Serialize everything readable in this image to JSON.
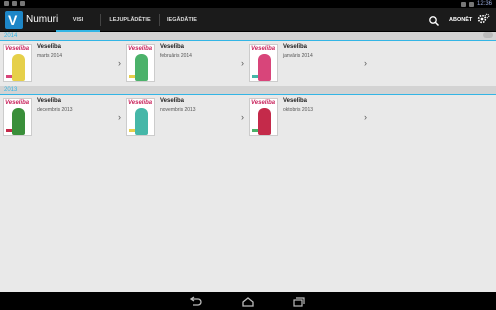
{
  "status_bar": {
    "time": "12:36"
  },
  "action_bar": {
    "title": "Numuri",
    "tabs": [
      {
        "label": "VISI",
        "active": true
      },
      {
        "label": "LEJUPLĀDĒTIE",
        "active": false
      },
      {
        "label": "IEGĀDĀTIE",
        "active": false
      }
    ],
    "subscribe_label": "ABONĒT",
    "icons": [
      "app-logo-icon",
      "search-icon",
      "gear-icon"
    ]
  },
  "sections": [
    {
      "year": "2014",
      "issues": [
        {
          "title": "Veselība",
          "date": "marts 2014"
        },
        {
          "title": "Veselība",
          "date": "februāris 2014"
        },
        {
          "title": "Veselība",
          "date": "janvāris 2014"
        }
      ]
    },
    {
      "year": "2013",
      "issues": [
        {
          "title": "Veselība",
          "date": "decembris 2013"
        },
        {
          "title": "Veselība",
          "date": "novembris 2013"
        },
        {
          "title": "Veselība",
          "date": "oktobris 2013"
        }
      ]
    }
  ],
  "covers": {
    "masthead": "Veselība",
    "colors": [
      "#e6d04a",
      "#4bb26a",
      "#d8457a",
      "#3a8f3a",
      "#45b7a8",
      "#c42a4a"
    ]
  },
  "nav_bar": {
    "icons": [
      "back-icon",
      "home-icon",
      "recent-apps-icon"
    ]
  },
  "theme": {
    "accent": "#33b5e5",
    "actionbar_bg": "#1b1b1b",
    "content_bg": "#e9e9e9"
  }
}
